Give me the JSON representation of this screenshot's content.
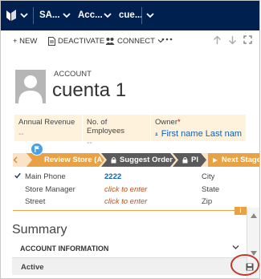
{
  "topnav": {
    "app_short": "SA...",
    "area": "Acc...",
    "record": "cue..."
  },
  "commands": {
    "new_label": "+ NEW",
    "deactivate_label": "DEACTIVATE",
    "connect_label": "CONNECT"
  },
  "header": {
    "entity": "ACCOUNT",
    "title": "cuenta 1",
    "annual_revenue_label": "Annual Revenue",
    "annual_revenue_value": "--",
    "employees_label": "No. of Employees",
    "employees_value": "--",
    "owner_label": "Owner",
    "owner_required": "*",
    "owner_value": "First name Last nam"
  },
  "process": {
    "stages": [
      "Review Store (A",
      "Suggest Order",
      "Pl"
    ],
    "next_label": "Next Stage"
  },
  "fields": {
    "main_phone_label": "Main Phone",
    "main_phone_value": "2222",
    "store_manager_label": "Store Manager",
    "store_manager_value": "click to enter",
    "street_label": "Street",
    "street_value": "click to enter",
    "city_label": "City",
    "state_label": "State",
    "zip_label": "Zip"
  },
  "info_badge": "i",
  "summary": {
    "title": "Summary",
    "section": "ACCOUNT INFORMATION"
  },
  "status": {
    "value": "Active"
  },
  "colors": {
    "nav": "#002050",
    "accent": "#e9a243",
    "link": "#1160b7",
    "highlight": "#c0392b"
  }
}
